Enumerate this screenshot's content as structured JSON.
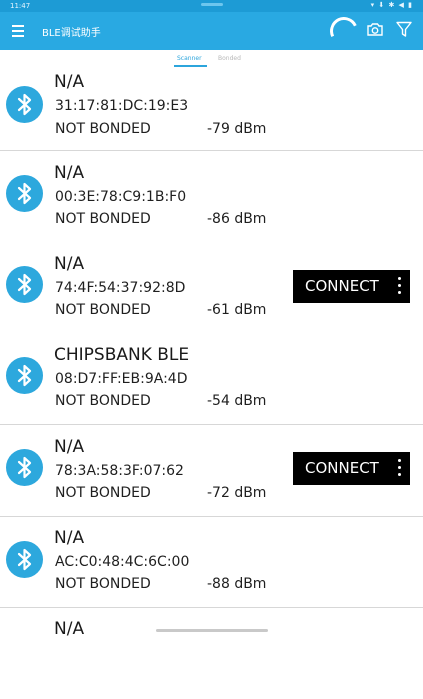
{
  "status_bar": {
    "time": "11:47",
    "right_icons": "▾ ⬇ ✱ ◀ ▮"
  },
  "app_bar": {
    "title": "BLE调试助手"
  },
  "tabs": [
    {
      "label": "Scanner",
      "active": true
    },
    {
      "label": "Bonded",
      "active": false
    }
  ],
  "devices": [
    {
      "name": "N/A",
      "mac": "31:17:81:DC:19:E3",
      "bond": "NOT BONDED",
      "rssi": "-79 dBm",
      "connectable": false
    },
    {
      "name": "N/A",
      "mac": "00:3E:78:C9:1B:F0",
      "bond": "NOT BONDED",
      "rssi": "-86 dBm",
      "connectable": false
    },
    {
      "name": "N/A",
      "mac": "74:4F:54:37:92:8D",
      "bond": "NOT BONDED",
      "rssi": "-61 dBm",
      "connectable": true
    },
    {
      "name": "CHIPSBANK BLE",
      "mac": "08:D7:FF:EB:9A:4D",
      "bond": "NOT BONDED",
      "rssi": "-54 dBm",
      "connectable": false
    },
    {
      "name": "N/A",
      "mac": "78:3A:58:3F:07:62",
      "bond": "NOT BONDED",
      "rssi": "-72 dBm",
      "connectable": true
    },
    {
      "name": "N/A",
      "mac": "AC:C0:48:4C:6C:00",
      "bond": "NOT BONDED",
      "rssi": "-88 dBm",
      "connectable": false
    },
    {
      "name": "N/A"
    }
  ],
  "connect_label": "CONNECT",
  "colors": {
    "accent": "#29a9e2",
    "status_bar": "#1d9bd5",
    "button": "#000000"
  },
  "icons": {
    "menu": "menu-icon",
    "progress": "refresh-spinner",
    "camera": "camera-icon",
    "filter": "filter-icon",
    "device": "bluetooth-icon",
    "more": "more-vert-icon"
  }
}
